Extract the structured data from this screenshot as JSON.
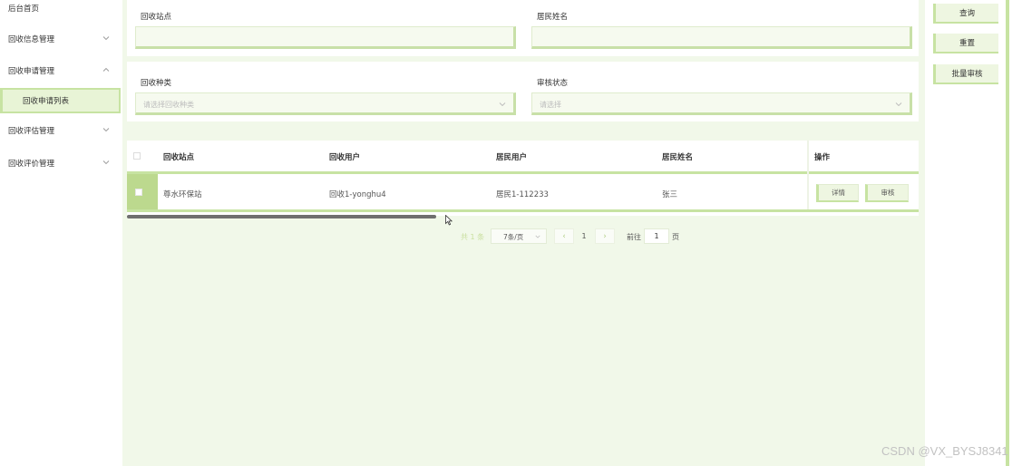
{
  "sidebar": {
    "items": [
      {
        "label": "后台首页"
      },
      {
        "label": "回收信息管理"
      },
      {
        "label": "回收申请管理"
      },
      {
        "label": "回收申请列表"
      },
      {
        "label": "回收评估管理"
      },
      {
        "label": "回收评价管理"
      }
    ]
  },
  "filters": {
    "station_label": "回收站点",
    "resident_name_label": "居民姓名",
    "category_label": "回收种类",
    "category_placeholder": "请选择回收种类",
    "audit_status_label": "审核状态",
    "audit_status_placeholder": "请选择"
  },
  "actions": {
    "query": "查询",
    "reset": "重置",
    "batch_audit": "批量审核"
  },
  "table": {
    "columns": [
      "回收站点",
      "回收用户",
      "居民用户",
      "居民姓名",
      "操作"
    ],
    "rows": [
      {
        "station": "尊水环保站",
        "recycle_user": "回收1-yonghu4",
        "resident_user": "居民1-112233",
        "resident_name": "张三",
        "detail_label": "详情",
        "audit_label": "审核"
      }
    ]
  },
  "pagination": {
    "total": "共 1 条",
    "page_size": "7条/页",
    "prev": "‹",
    "current_page": "1",
    "next": "›",
    "goto_prefix": "前往",
    "goto_value": "1",
    "goto_suffix": "页"
  },
  "watermark": "CSDN @VX_BYSJ8341",
  "colors": {
    "accent": "#c7e3a2",
    "background": "#f1f8e9",
    "active_row": "#bcd98e"
  }
}
